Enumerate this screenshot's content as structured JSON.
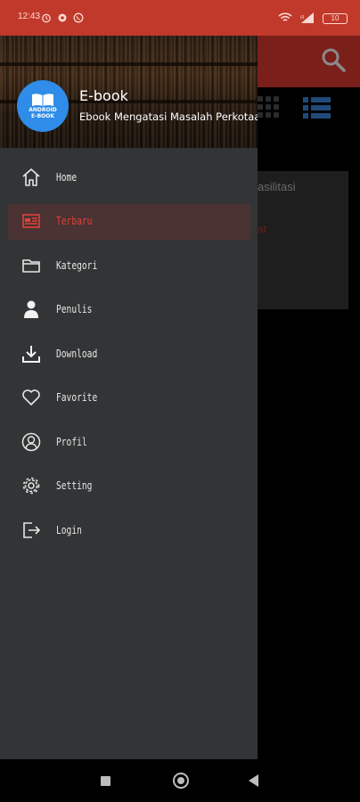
{
  "status_bar": {
    "time": "12:43",
    "battery": "10",
    "icons": [
      "alarm-icon",
      "settings-icon",
      "whatsapp-icon",
      "wifi-icon",
      "signal-icon",
      "battery-icon"
    ]
  },
  "background": {
    "card_title": "asilitasi",
    "card_sub": "at"
  },
  "drawer": {
    "app_name": "E-book",
    "app_subtitle": "Ebook Mengatasi Masalah Perkotaan",
    "logo_text_line1": "ANDROID",
    "logo_text_line2": "E-BOOK",
    "items": [
      {
        "label": "Home",
        "icon": "home-icon"
      },
      {
        "label": "Terbaru",
        "icon": "newspaper-icon",
        "active": true
      },
      {
        "label": "Kategori",
        "icon": "folder-icon"
      },
      {
        "label": "Penulis",
        "icon": "person-icon"
      },
      {
        "label": "Download",
        "icon": "download-icon"
      },
      {
        "label": "Favorite",
        "icon": "heart-icon"
      },
      {
        "label": "Profil",
        "icon": "profile-icon"
      },
      {
        "label": "Setting",
        "icon": "gear-icon"
      },
      {
        "label": "Login",
        "icon": "login-icon"
      }
    ]
  },
  "colors": {
    "status_bar": "#c0392b",
    "drawer_bg": "#333435",
    "active_text": "#e0413a",
    "logo_bg": "#2f8ce8"
  }
}
